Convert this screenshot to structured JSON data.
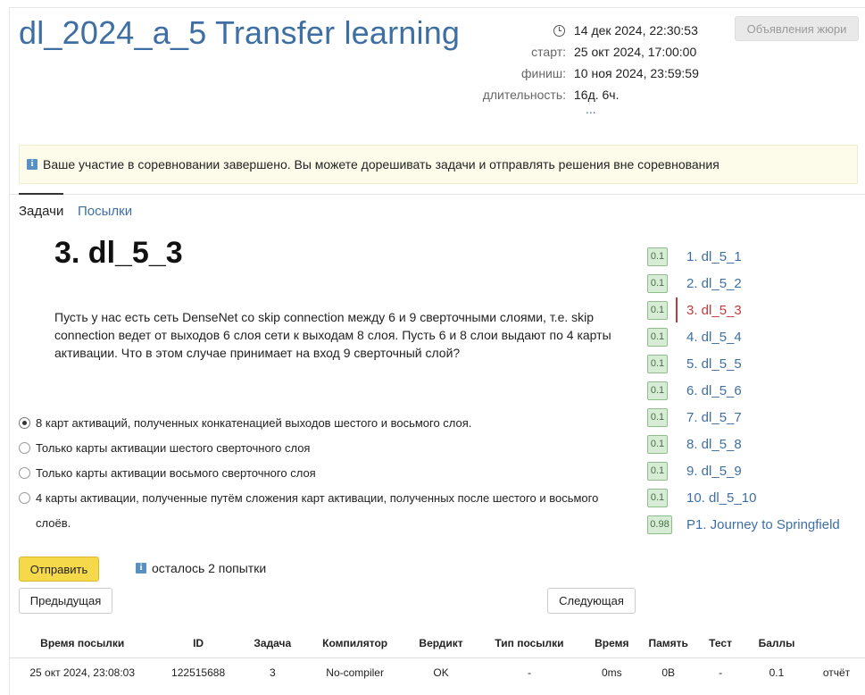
{
  "contest": {
    "title": "dl_2024_a_5 Transfer learning",
    "now": "14 дек 2024, 22:30:53",
    "start_label": "старт:",
    "start": "25 окт 2024, 17:00:00",
    "finish_label": "финиш:",
    "finish": "10 ноя 2024, 23:59:59",
    "duration_label": "длительность:",
    "duration": "16д. 6ч.",
    "more": "...",
    "jury_button": "Объявления жюри"
  },
  "notice": {
    "icon": "info-icon",
    "text": "Ваше участие в соревновании завершено. Вы можете дорешивать задачи и отправлять решения вне соревнования"
  },
  "tabs": [
    {
      "label": "Задачи",
      "active": true
    },
    {
      "label": "Посылки",
      "active": false
    }
  ],
  "problem": {
    "title": "3. dl_5_3",
    "statement": "Пусть у нас есть сеть DenseNet со skip connection между 6 и 9 сверточными слоями, т.е. skip connection ведет от выходов 6 слоя сети к выходам 8 слоя. Пусть 6 и 8 слои выдают по 4 карты активации. Что в этом случае принимает на вход 9 сверточный слой?",
    "options": [
      {
        "text": "8 карт активаций, полученных конкатенацией выходов шестого и восьмого слоя.",
        "checked": true
      },
      {
        "text": "Только карты активации шестого сверточного слоя",
        "checked": false
      },
      {
        "text": "Только карты активации восьмого сверточного слоя",
        "checked": false
      },
      {
        "text": "4 карты активации, полученные путём сложения карт активации, полученных после шестого и восьмого слоёв.",
        "checked": false
      }
    ],
    "submit_label": "Отправить",
    "attempts_text": "осталось 2 попытки",
    "prev_label": "Предыдущая",
    "next_label": "Следующая"
  },
  "sidebar": {
    "items": [
      {
        "score": "0.1",
        "label": "1. dl_5_1"
      },
      {
        "score": "0.1",
        "label": "2. dl_5_2"
      },
      {
        "score": "0.1",
        "label": "3. dl_5_3",
        "active": true
      },
      {
        "score": "0.1",
        "label": "4. dl_5_4"
      },
      {
        "score": "0.1",
        "label": "5. dl_5_5"
      },
      {
        "score": "0.1",
        "label": "6. dl_5_6"
      },
      {
        "score": "0.1",
        "label": "7. dl_5_7"
      },
      {
        "score": "0.1",
        "label": "8. dl_5_8"
      },
      {
        "score": "0.1",
        "label": "9. dl_5_9"
      },
      {
        "score": "0.1",
        "label": "10. dl_5_10"
      },
      {
        "score": "0.98",
        "label": "P1. Journey to Springfield"
      }
    ]
  },
  "submissions": {
    "headers": [
      "Время посылки",
      "ID",
      "Задача",
      "Компилятор",
      "Вердикт",
      "Тип посылки",
      "Время",
      "Память",
      "Тест",
      "Баллы",
      ""
    ],
    "rows": [
      [
        "25 окт 2024, 23:08:03",
        "122515688",
        "3",
        "No-compiler",
        "OK",
        "-",
        "0ms",
        "0B",
        "-",
        "0.1",
        "отчёт"
      ]
    ]
  },
  "colors": {
    "link": "#3e6fa3",
    "active": "#c23b3b",
    "ok": "#2e8b2e",
    "submit": "#f6d94b",
    "notice_bg": "#fdfcea"
  }
}
